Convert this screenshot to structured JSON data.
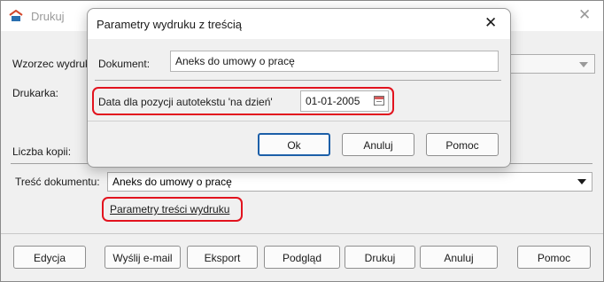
{
  "main_window": {
    "title": "Drukuj",
    "close_glyph": "✕",
    "labels": {
      "template": "Wzorzec wydruku:",
      "printer": "Drukarka:",
      "copies": "Liczba kopii:",
      "content": "Treść dokumentu:"
    },
    "content_select_value": "Aneks do umowy o pracę",
    "print_params_link": "Parametry treści wydruku",
    "buttons": {
      "edit": "Edycja",
      "email": "Wyślij e-mail",
      "export": "Eksport",
      "preview": "Podgląd",
      "print": "Drukuj",
      "cancel": "Anuluj",
      "help": "Pomoc"
    }
  },
  "dialog": {
    "title": "Parametry wydruku z treścią",
    "close_glyph": "✕",
    "document_label": "Dokument:",
    "document_value": "Aneks do umowy o pracę",
    "date_label": "Data dla pozycji autotekstu 'na dzień'",
    "date_value": "01-01-2005",
    "buttons": {
      "ok": "Ok",
      "cancel": "Anuluj",
      "help": "Pomoc"
    }
  },
  "colors": {
    "highlight_ring": "#e2131e",
    "default_button_border": "#1c5fa8",
    "window_bg": "#f0f0f0"
  },
  "icons": [
    "app-icon",
    "close-icon",
    "chevron-down-icon",
    "calendar-icon"
  ]
}
